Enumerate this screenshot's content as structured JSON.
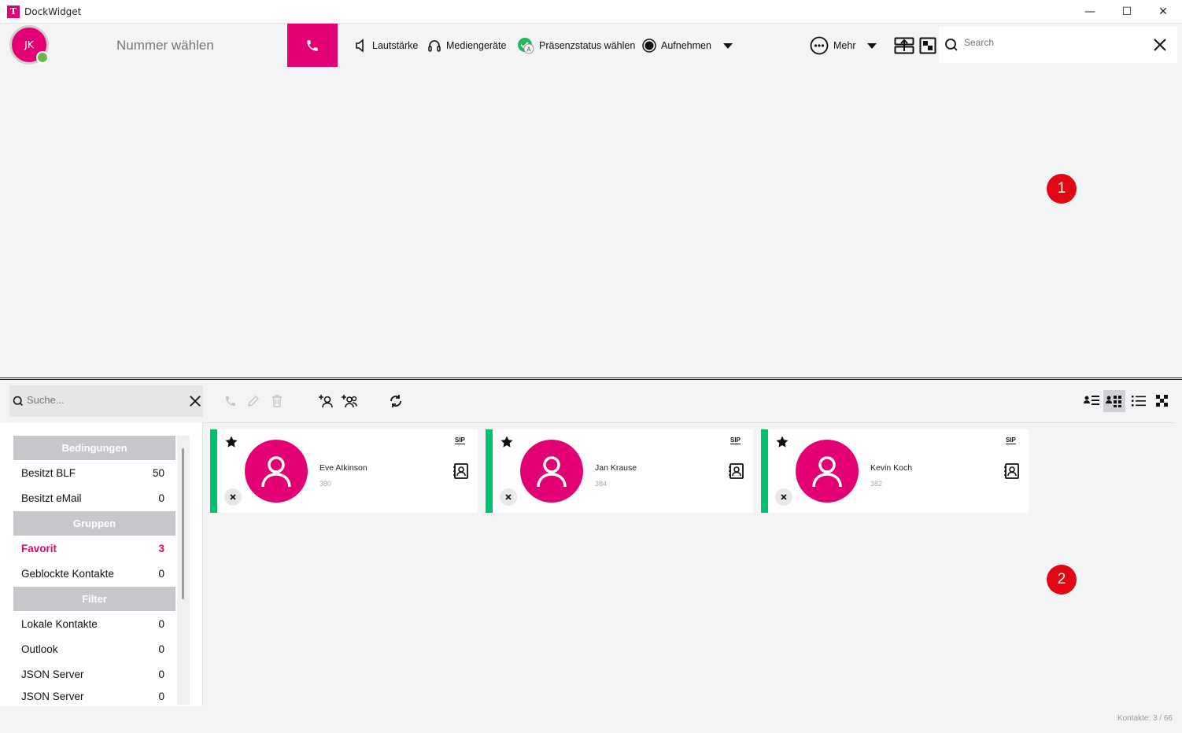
{
  "window": {
    "title": "DockWidget",
    "logo_letter": "T",
    "minimize": "—",
    "maximize": "☐",
    "close": "✕"
  },
  "toolbar": {
    "avatar_initials": "JK",
    "dial_placeholder": "Nummer wählen",
    "volume_label": "Lautstärke",
    "media_label": "Mediengeräte",
    "presence_label": "Präsenzstatus wählen",
    "record_label": "Aufnehmen",
    "more_label": "Mehr",
    "search_placeholder": "Search"
  },
  "annotations": {
    "badge_top": "1",
    "badge_bottom": "2"
  },
  "contacts_panel": {
    "search_placeholder": "Suche...",
    "footer_count": "Kontakte: 3 / 66"
  },
  "sidebar": {
    "sections": [
      {
        "header": "Bedingungen",
        "rows": [
          {
            "label": "Besitzt BLF",
            "count": "50"
          },
          {
            "label": "Besitzt eMail",
            "count": "0"
          }
        ]
      },
      {
        "header": "Gruppen",
        "rows": [
          {
            "label": "Favorit",
            "count": "3",
            "active": true
          },
          {
            "label": "Geblockte Kontakte",
            "count": "0"
          }
        ]
      },
      {
        "header": "Filter",
        "rows": [
          {
            "label": "Lokale Kontakte",
            "count": "0"
          },
          {
            "label": "Outlook",
            "count": "0"
          },
          {
            "label": "JSON Server",
            "count": "0"
          },
          {
            "label": "JSON Server",
            "count": "0"
          }
        ]
      }
    ]
  },
  "cards": [
    {
      "name": "Eve Atkinson",
      "number": "380",
      "sip": "SIP",
      "status_color": "#00c16e"
    },
    {
      "name": "Jan Krause",
      "number": "384",
      "sip": "SIP",
      "status_color": "#00c16e"
    },
    {
      "name": "Kevin Koch",
      "number": "382",
      "sip": "SIP",
      "status_color": "#00c16e"
    }
  ],
  "colors": {
    "brand": "#e20074",
    "online": "#00c16e",
    "badge": "#e30613"
  }
}
